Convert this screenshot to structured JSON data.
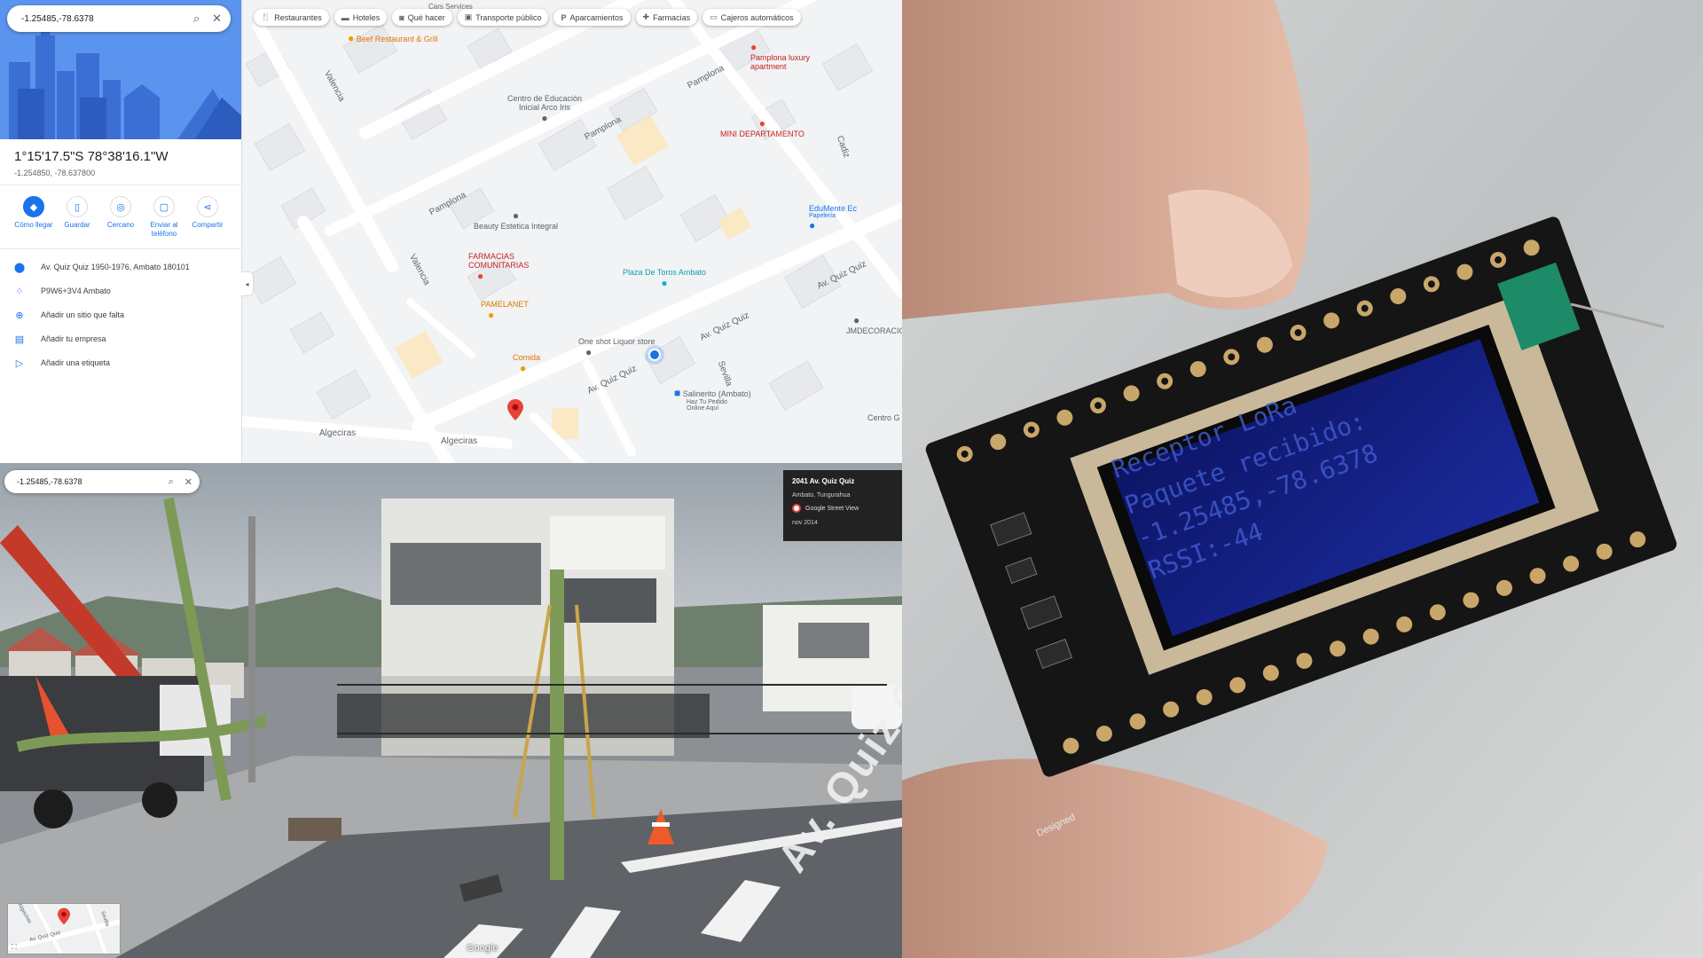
{
  "map": {
    "search_value": "-1.25485,-78.6378",
    "coords_dms": "1°15'17.5\"S 78°38'16.1\"W",
    "coords_decimal": "-1.254850, -78.637800",
    "actions": [
      {
        "label": "Cómo llegar",
        "icon": "directions-icon"
      },
      {
        "label": "Guardar",
        "icon": "bookmark-icon"
      },
      {
        "label": "Cercano",
        "icon": "nearby-icon"
      },
      {
        "label": "Enviar al teléfono",
        "icon": "phone-icon"
      },
      {
        "label": "Compartir",
        "icon": "share-icon"
      }
    ],
    "info_rows": [
      {
        "text": "Av. Quiz Quiz 1950-1976, Ambato 180101",
        "icon": "location-pin-icon"
      },
      {
        "text": "P9W6+3V4 Ambato",
        "icon": "plus-code-icon"
      },
      {
        "text": "Añadir un sitio que falta",
        "icon": "add-place-icon"
      },
      {
        "text": "Añadir tu empresa",
        "icon": "add-business-icon"
      },
      {
        "text": "Añadir una etiqueta",
        "icon": "label-icon"
      }
    ],
    "chips": [
      {
        "label": "Restaurantes",
        "icon": "utensils-icon"
      },
      {
        "label": "Hoteles",
        "icon": "bed-icon"
      },
      {
        "label": "Qué hacer",
        "icon": "camera-icon"
      },
      {
        "label": "Transporte público",
        "icon": "bus-icon"
      },
      {
        "label": "Aparcamientos",
        "icon": "parking-icon"
      },
      {
        "label": "Farmacias",
        "icon": "pharmacy-icon"
      },
      {
        "label": "Cajeros automáticos",
        "icon": "atm-icon"
      }
    ],
    "pois": {
      "beef": "Beef Restaurant & Grill",
      "cars": "Cars Services",
      "pamplona_apt": "Pamplona luxury apartment",
      "arco_iris": "Centro de Educación Inicial Arco Iris",
      "mini_depto": "MINI DEPARTAMENTO",
      "edumente": "EduMente Ec",
      "papeleria": "Papelería",
      "beauty": "Beauty Estetica Integral",
      "farmacias": "FARMACIAS COMUNITARIAS",
      "plaza": "Plaza De Toros Ambato",
      "pamelanet": "PAMELANET",
      "one_shot": "One shot Liquor store",
      "jmdecoracio": "JMDECORACIO",
      "comida": "Comida",
      "salinerito": "Salinerito (Ambato)",
      "salinerito_sub1": "Haz Tu Pedido",
      "salinerito_sub2": "Online Aquí",
      "centro": "Centro G"
    },
    "streets": {
      "valencia": "Valencia",
      "pamplona": "Pamplona",
      "quiz": "Av. Quiz Quiz",
      "sevilla": "Sevilla",
      "cadiz": "Cadiz",
      "algeciras": "Algeciras"
    }
  },
  "streetview": {
    "search_value": "-1.25485,-78.6378",
    "address": "2041 Av. Quiz Quiz",
    "city": "Ambato, Tungurahua",
    "source": "Google Street View",
    "date": "nov 2014",
    "brand": "Google",
    "sign_text": "Av. Quiz Quiz",
    "minimap_labels": [
      "Av. Quiz Quiz",
      "Sevilla",
      "Algeciras"
    ]
  },
  "device": {
    "oled_lines": [
      "Receptor LoRa",
      "Paquete recibido:",
      "-1.25485,-78.6378",
      "RSSI:-44"
    ],
    "board_text": "Designed"
  },
  "colors": {
    "map_bg": "#f1f3f4",
    "accent": "#1a73e8",
    "poi_red": "#ea4335",
    "poi_orange": "#f29900",
    "poi_teal": "#12b5cb",
    "oled_bg": "#101a78",
    "oled_text": "#3c54c4"
  }
}
